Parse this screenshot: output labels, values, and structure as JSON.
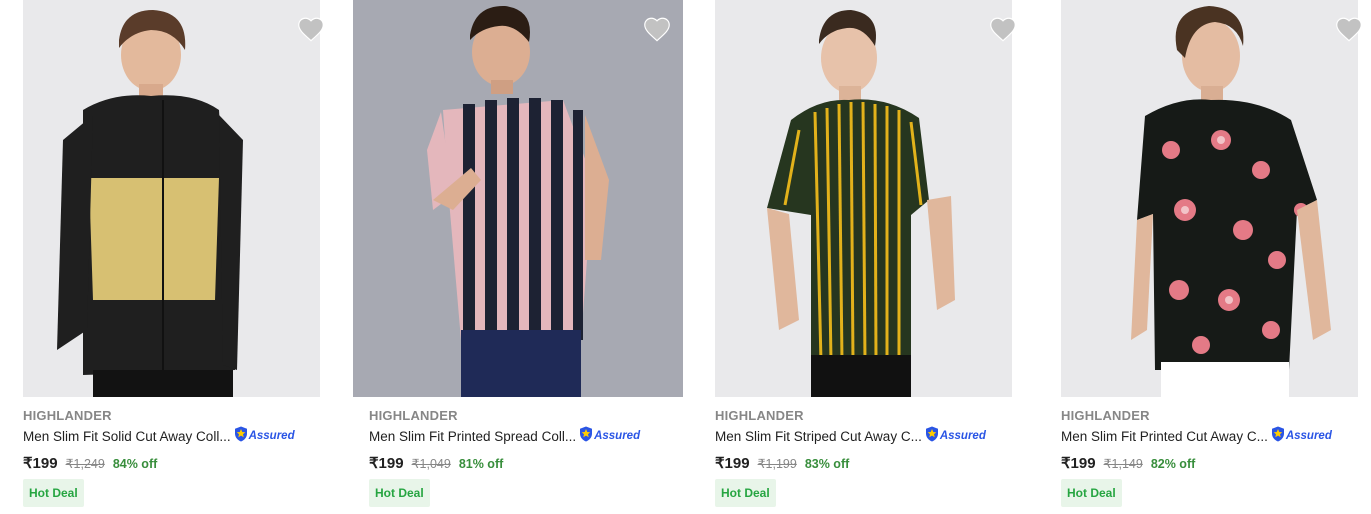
{
  "products": [
    {
      "brand": "HIGHLANDER",
      "title": "Men Slim Fit Solid Cut Away Coll...",
      "assured": "Assured",
      "price": "₹199",
      "mrp": "₹1,249",
      "discount": "84% off",
      "deal": "Hot Deal",
      "image": "model in black and mustard colour-block full-sleeve shirt"
    },
    {
      "brand": "HIGHLANDER",
      "title": "Men Slim Fit Printed Spread Coll...",
      "assured": "Assured",
      "price": "₹199",
      "mrp": "₹1,049",
      "discount": "81% off",
      "deal": "Hot Deal",
      "image": "model in pink and navy striped short-sleeve shirt"
    },
    {
      "brand": "HIGHLANDER",
      "title": "Men Slim Fit Striped Cut Away C...",
      "assured": "Assured",
      "price": "₹199",
      "mrp": "₹1,199",
      "discount": "83% off",
      "deal": "Hot Deal",
      "image": "model in green and yellow striped short-sleeve shirt"
    },
    {
      "brand": "HIGHLANDER",
      "title": "Men Slim Fit Printed Cut Away C...",
      "assured": "Assured",
      "price": "₹199",
      "mrp": "₹1,149",
      "discount": "82% off",
      "deal": "Hot Deal",
      "image": "model in black floral print short-sleeve shirt"
    }
  ],
  "colors": {
    "brand_text": "#878787",
    "title_text": "#212121",
    "discount": "#388e3c",
    "deal_bg": "#e8f5e9",
    "deal_text": "#26a541",
    "assured": "#2a55e5",
    "wishlist_heart": "#c2c2c2"
  },
  "icons": {
    "wishlist": "heart-icon",
    "assured": "shield-assured-icon"
  }
}
